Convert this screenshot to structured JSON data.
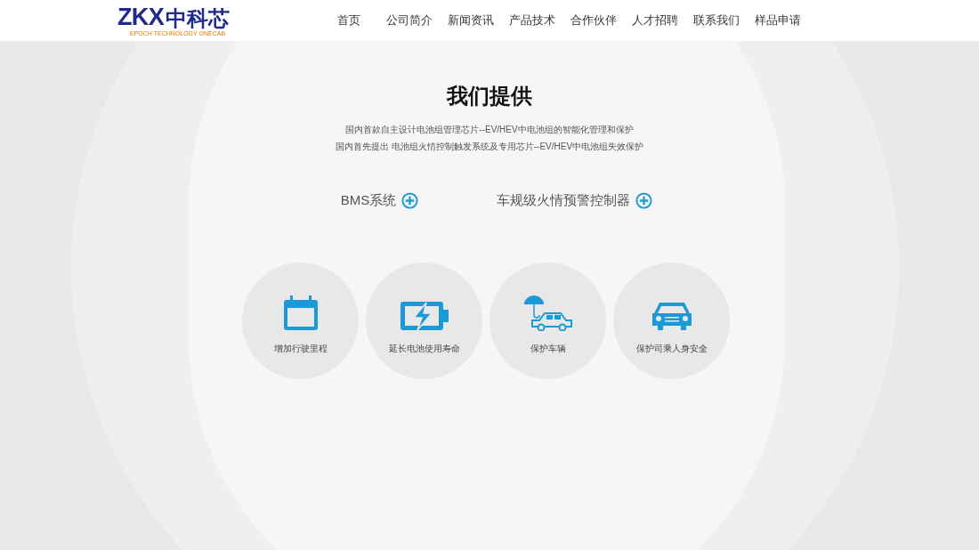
{
  "logo": {
    "letters": "ZKX",
    "name": "中科芯",
    "tagline": "EPOCH TECHNOLOGY ONECAB"
  },
  "nav": [
    {
      "label": "首页"
    },
    {
      "label": "公司简介"
    },
    {
      "label": "新闻资讯"
    },
    {
      "label": "产品技术"
    },
    {
      "label": "合作伙伴"
    },
    {
      "label": "人才招聘"
    },
    {
      "label": "联系我们"
    },
    {
      "label": "样品申请"
    }
  ],
  "section": {
    "title": "我们提供",
    "lines": [
      "国内首款自主设计电池组管理芯片--EV/HEV中电池组的智能化管理和保护",
      "国内首先提出 电池组火情控制触发系统及专用芯片--EV/HEV中电池组失效保护"
    ]
  },
  "products": [
    {
      "label": "BMS系统"
    },
    {
      "label": "车规级火情预警控制器"
    }
  ],
  "features": [
    {
      "kind": "calendar",
      "label": "增加行驶里程"
    },
    {
      "kind": "battery",
      "label": "延长电池使用寿命"
    },
    {
      "kind": "umbrella-car",
      "label": "保护车辆"
    },
    {
      "kind": "car",
      "label": "保护司乘人身安全"
    }
  ]
}
